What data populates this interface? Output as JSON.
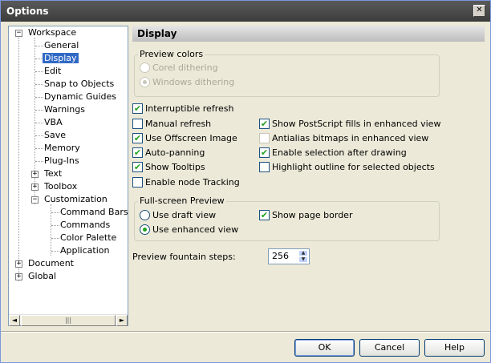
{
  "window": {
    "title": "Options",
    "close_icon": "✕"
  },
  "tree": {
    "items": [
      {
        "label": "Workspace",
        "expander": "−"
      },
      {
        "label": "General"
      },
      {
        "label": "Display"
      },
      {
        "label": "Edit"
      },
      {
        "label": "Snap to Objects"
      },
      {
        "label": "Dynamic Guides"
      },
      {
        "label": "Warnings"
      },
      {
        "label": "VBA"
      },
      {
        "label": "Save"
      },
      {
        "label": "Memory"
      },
      {
        "label": "Plug-Ins"
      },
      {
        "label": "Text",
        "expander": "+"
      },
      {
        "label": "Toolbox",
        "expander": "+"
      },
      {
        "label": "Customization",
        "expander": "−"
      },
      {
        "label": "Command Bars"
      },
      {
        "label": "Commands"
      },
      {
        "label": "Color Palette"
      },
      {
        "label": "Application"
      },
      {
        "label": "Document",
        "expander": "+"
      },
      {
        "label": "Global",
        "expander": "+"
      }
    ],
    "scroll_left": "◄",
    "scroll_right": "►",
    "scroll_grip": "|||"
  },
  "panel": {
    "title": "Display",
    "preview_colors": {
      "title": "Preview colors",
      "corel": "Corel dithering",
      "windows": "Windows dithering"
    },
    "options": {
      "interruptible_refresh": "Interruptible refresh",
      "manual_refresh": "Manual refresh",
      "offscreen_image": "Use Offscreen Image",
      "auto_panning": "Auto-panning",
      "show_tooltips": "Show Tooltips",
      "node_tracking": "Enable node Tracking",
      "postscript_fills": "Show PostScript fills in enhanced view",
      "antialias": "Antialias bitmaps in enhanced view",
      "selection_after_drawing": "Enable selection after drawing",
      "highlight_outline": "Highlight outline for selected objects"
    },
    "fullscreen": {
      "title": "Full-screen Preview",
      "draft": "Use draft view",
      "enhanced": "Use enhanced view",
      "page_border": "Show page border"
    },
    "fountain": {
      "label": "Preview fountain steps:",
      "value": "256"
    }
  },
  "checkmark": "✔",
  "buttons": {
    "ok": "OK",
    "cancel": "Cancel",
    "help": "Help"
  }
}
